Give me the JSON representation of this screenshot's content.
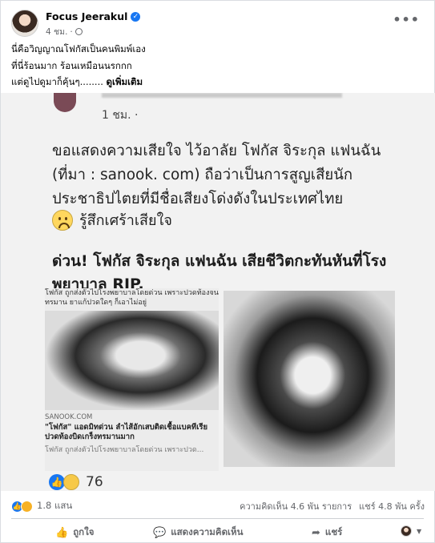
{
  "post": {
    "author": "Focus Jeerakul",
    "time": "4 ชม.",
    "separator": "·",
    "caption_lines": [
      "นี่คือวิญญาณโฟกัสเป็นคนพิมพ์เอง",
      "ที่นี่ร้อนมาก ร้อนเหมือนนรกกก",
      "แต่ดูไปดูมาก็คุ้นๆ........"
    ],
    "see_more": "ดูเพิ่มเติม"
  },
  "embedded": {
    "time": "1 ชม. ·",
    "body": "ขอแสดงความเสียใจ ไว้อาลัย โฟกัส จิระกุล แฟนฉัน (ที่มา : sanook. com) ถือว่าเป็นการสูญเสียนักประชาธิปไตยที่มีชื่อเสียงโด่งดังในประเทศไทย",
    "feeling": "รู้สึกเศร้าเสียใจ",
    "headline": "ด่วน! โฟกัส จิระกุล แฟนฉัน เสียชีวิตกะทันหันที่โรงพยาบาล RIP.",
    "left_caption": "โฟกัส ถูกส่งตัวไปโรงพยาบาลโดยด่วน เพราะปวดท้องจนทรมาน ยาแก้ปวดใดๆ ก็เอาไม่อยู่",
    "source": "SANOOK.COM",
    "left_title": "\"โฟกัส\" แอดมิทด่วน ลำไส้อักเสบติดเชื้อแบคทีเรีย ปวดท้องบิดเกร็งทรมานมาก",
    "left_sub": "โฟกัส ถูกส่งตัวไปโรงพยาบาลโดยด่วน เพราะปวด...",
    "reaction_count": "76"
  },
  "footer": {
    "reaction_count": "1.8 แสน",
    "comments": "ความคิดเห็น 4.6 พัน รายการ",
    "shares": "แชร์ 4.8 พัน ครั้ง",
    "like_label": "ถูกใจ",
    "comment_label": "แสดงความคิดเห็น",
    "share_label": "แชร์"
  },
  "icons": {
    "verified": "verified-badge-icon",
    "globe": "globe-icon",
    "more": "more-options-icon",
    "like": "thumbs-up-icon",
    "comment": "comment-bubble-icon",
    "share": "share-arrow-icon"
  },
  "colors": {
    "accent": "#1877f2",
    "text": "#050505",
    "secondary_text": "#65676b",
    "divider": "#ced0d4"
  }
}
